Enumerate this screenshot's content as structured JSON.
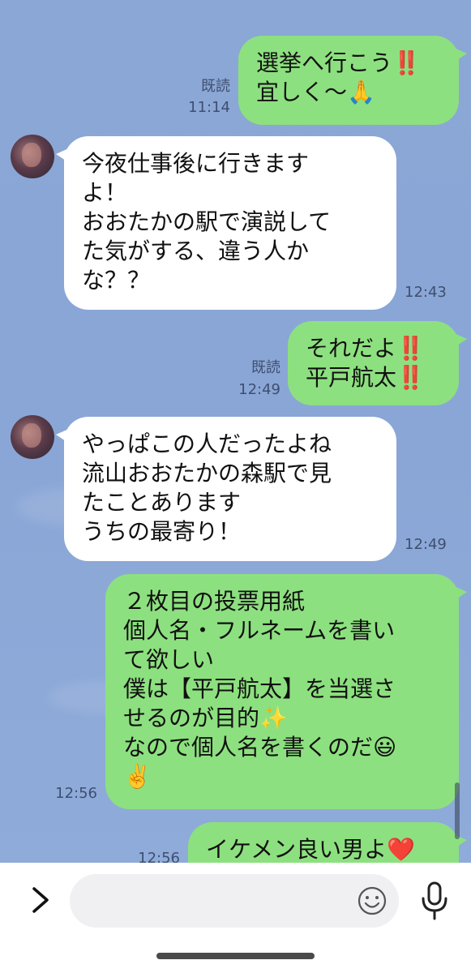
{
  "messages": [
    {
      "id": "m1",
      "side": "out",
      "text": "選挙へ行こう‼️\n宜しく〜🙏",
      "read": "既読",
      "time": "11:14"
    },
    {
      "id": "m2",
      "side": "in",
      "text": "今夜仕事後に行きます\nよ！\nおおたかの駅で演説して\nた気がする、違う人か\nな？？",
      "time": "12:43"
    },
    {
      "id": "m3",
      "side": "out",
      "text": "それだよ‼️\n平戸航太‼️",
      "read": "既読",
      "time": "12:49"
    },
    {
      "id": "m4",
      "side": "in",
      "text": "やっぱこの人だったよね\n流山おおたかの森駅で見\nたことあります\nうちの最寄り！",
      "time": "12:49"
    },
    {
      "id": "m5",
      "side": "out",
      "text": "２枚目の投票用紙\n個人名・フルネームを書い\nて欲しい\n僕は【平戸航太】を当選さ\nせるのが目的✨\nなので個人名を書くのだ😃\n✌️",
      "time": "12:56"
    },
    {
      "id": "m6",
      "side": "out",
      "text": "イケメン良い男よ❤️",
      "time": "12:56"
    }
  ],
  "input": {
    "placeholder": ""
  },
  "colors": {
    "outgoing_bubble": "#8de07f",
    "incoming_bubble": "#ffffff",
    "background": "#8aa7d6"
  },
  "icons": {
    "expand": "chevron-right-icon",
    "emoji": "smiley-icon",
    "voice": "microphone-icon"
  }
}
